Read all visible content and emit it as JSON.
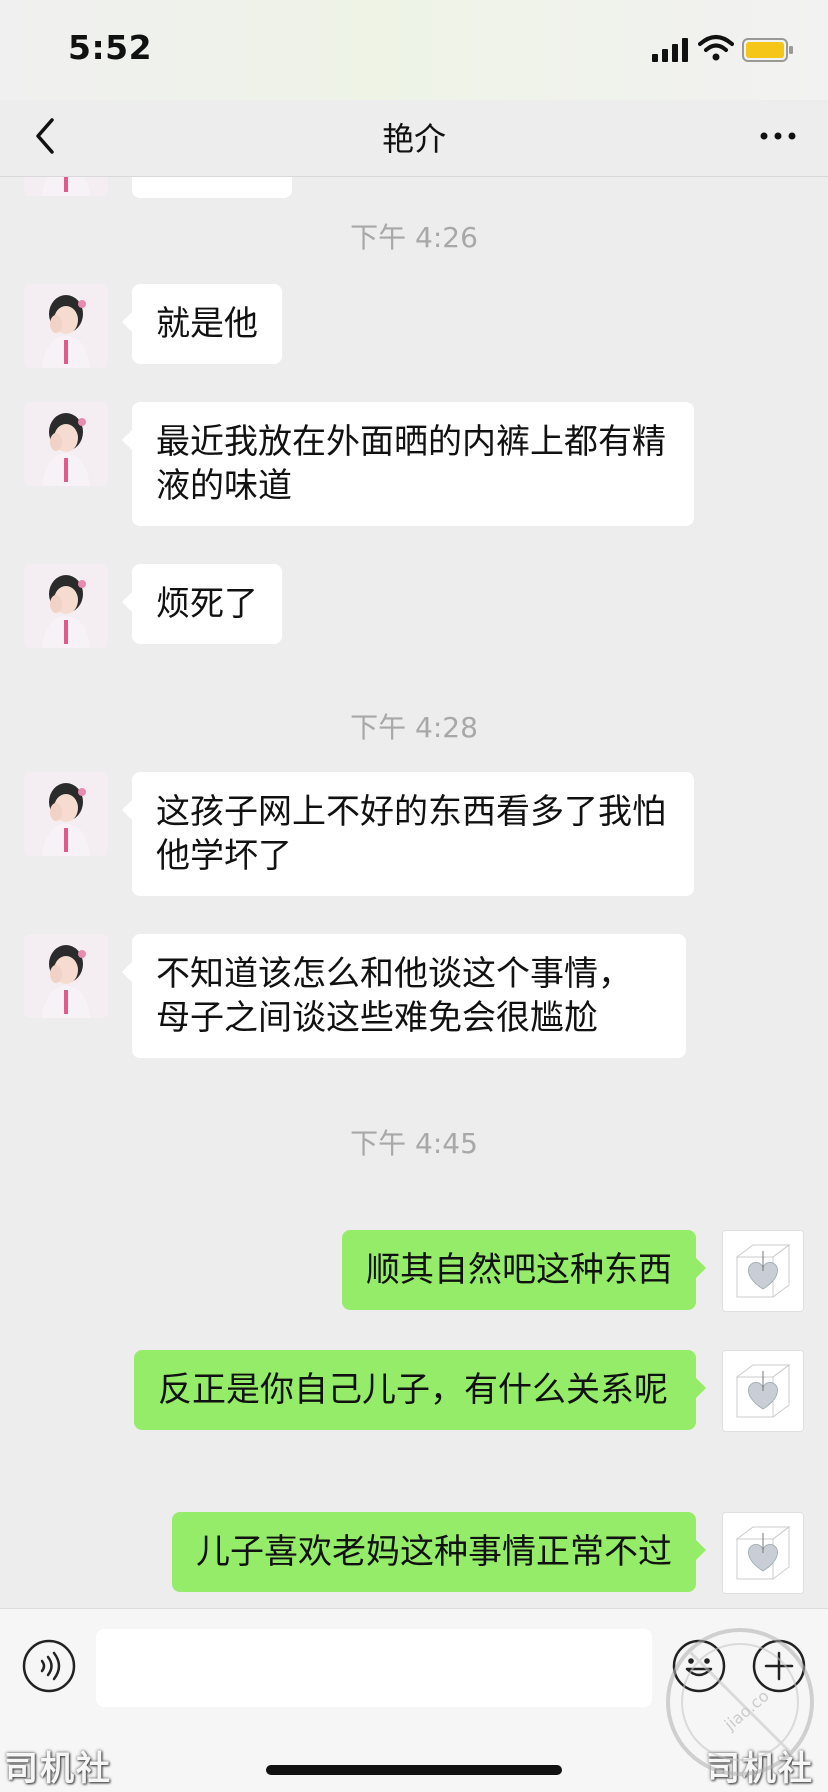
{
  "status_bar": {
    "time": "5:52"
  },
  "nav": {
    "title": "艳介",
    "back_icon": "chevron-left-icon",
    "more_icon": "more-dots-icon"
  },
  "colors": {
    "background": "#ededed",
    "incoming_bubble": "#ffffff",
    "outgoing_bubble": "#95ec69",
    "timestamp_text": "#a8a8a8"
  },
  "chat": {
    "timestamps": [
      "下午 4:26",
      "下午 4:28",
      "下午 4:45"
    ],
    "messages": [
      {
        "direction": "in",
        "text": ""
      },
      {
        "direction": "in",
        "text": "就是他"
      },
      {
        "direction": "in",
        "text": "最近我放在外面晒的内裤上都有精液的味道"
      },
      {
        "direction": "in",
        "text": "烦死了"
      },
      {
        "direction": "in",
        "text": "这孩子网上不好的东西看多了我怕他学坏了"
      },
      {
        "direction": "in",
        "text": "不知道该怎么和他谈这个事情，母子之间谈这些难免会很尴尬"
      },
      {
        "direction": "out",
        "text": "顺其自然吧这种东西"
      },
      {
        "direction": "out",
        "text": "反正是你自己儿子，有什么关系呢"
      },
      {
        "direction": "out",
        "text": "儿子喜欢老妈这种事情正常不过"
      }
    ]
  },
  "input_bar": {
    "placeholder": "",
    "voice_icon": "voice-icon",
    "emoji_icon": "emoji-icon",
    "plus_icon": "plus-icon"
  },
  "watermark": {
    "left": "司机社",
    "right": "司机社",
    "seal_text": "jiao.co"
  }
}
